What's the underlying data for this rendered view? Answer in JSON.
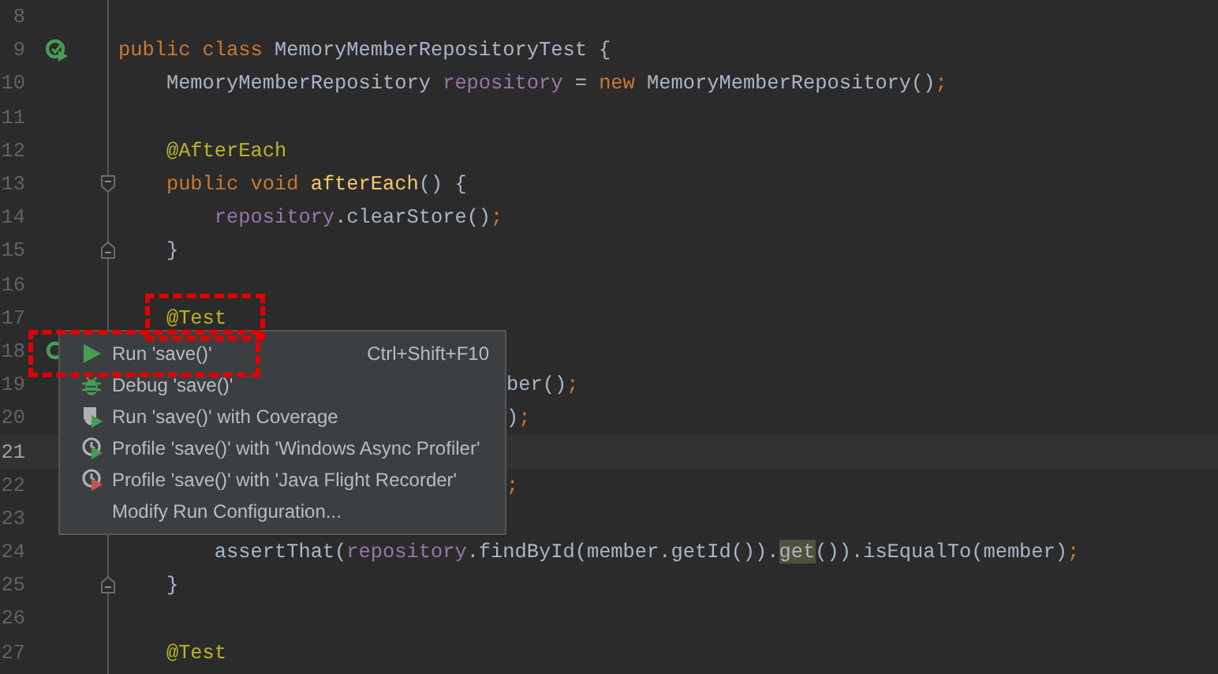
{
  "editor": {
    "lines": [
      {
        "number": "8",
        "current": false
      },
      {
        "number": "9",
        "current": false,
        "gutter_marker": {
          "kind": "run-all"
        },
        "tokens": [
          {
            "kind": "keyword",
            "text": "public class "
          },
          {
            "kind": "plain",
            "text": "MemoryMemberRepositoryTest {"
          }
        ]
      },
      {
        "number": "10",
        "current": false,
        "tokens": [
          {
            "kind": "plain",
            "text": "    MemoryMemberRepository "
          },
          {
            "kind": "field",
            "text": "repository"
          },
          {
            "kind": "plain",
            "text": " = "
          },
          {
            "kind": "keyword",
            "text": "new "
          },
          {
            "kind": "plain",
            "text": "MemoryMemberRepository()"
          },
          {
            "kind": "keyword",
            "text": ";"
          }
        ]
      },
      {
        "number": "11",
        "current": false
      },
      {
        "number": "12",
        "current": false,
        "tokens": [
          {
            "kind": "annotation",
            "text": "    @AfterEach"
          }
        ]
      },
      {
        "number": "13",
        "current": false,
        "fold_marker": {
          "kind": "start"
        },
        "tokens": [
          {
            "kind": "keyword",
            "text": "    public void "
          },
          {
            "kind": "method",
            "text": "afterEach"
          },
          {
            "kind": "plain",
            "text": "() {"
          }
        ]
      },
      {
        "number": "14",
        "current": false,
        "tokens": [
          {
            "kind": "field",
            "text": "        repository"
          },
          {
            "kind": "plain",
            "text": ".clearStore()"
          },
          {
            "kind": "keyword",
            "text": ";"
          }
        ]
      },
      {
        "number": "15",
        "current": false,
        "fold_marker": {
          "kind": "end"
        },
        "tokens": [
          {
            "kind": "plain",
            "text": "    }"
          }
        ]
      },
      {
        "number": "16",
        "current": false
      },
      {
        "number": "17",
        "current": false,
        "tokens": [
          {
            "kind": "annotation",
            "text": "    @Test"
          }
        ]
      },
      {
        "number": "18",
        "current": false,
        "gutter_marker": {
          "kind": "run"
        }
      },
      {
        "number": "19",
        "current": false,
        "covered": true,
        "tokens": [
          {
            "kind": "plain",
            "text": "ber()"
          },
          {
            "kind": "keyword",
            "text": ";"
          }
        ]
      },
      {
        "number": "20",
        "current": false,
        "covered": true,
        "tokens": [
          {
            "kind": "plain",
            "text": ")"
          },
          {
            "kind": "keyword",
            "text": ";"
          }
        ]
      },
      {
        "number": "21",
        "current": true
      },
      {
        "number": "22",
        "current": false,
        "covered": true,
        "tokens": [
          {
            "kind": "keyword",
            "text": ";"
          }
        ]
      },
      {
        "number": "23",
        "current": false
      },
      {
        "number": "24",
        "current": false,
        "tokens": [
          {
            "kind": "plain",
            "text": "        assertThat("
          },
          {
            "kind": "field",
            "text": "repository"
          },
          {
            "kind": "plain",
            "text": ".findById(member.getId())."
          },
          {
            "kind": "marked",
            "text": "get"
          },
          {
            "kind": "plain",
            "text": "()).isEqualTo(member)"
          },
          {
            "kind": "keyword",
            "text": ";"
          }
        ]
      },
      {
        "number": "25",
        "current": false,
        "fold_marker": {
          "kind": "end"
        },
        "tokens": [
          {
            "kind": "plain",
            "text": "    }"
          }
        ]
      },
      {
        "number": "26",
        "current": false
      },
      {
        "number": "27",
        "current": false,
        "tokens": [
          {
            "kind": "annotation",
            "text": "    @Test"
          }
        ]
      }
    ]
  },
  "context_menu": {
    "items": [
      {
        "kind": "run",
        "label": "Run 'save()'",
        "shortcut": "Ctrl+Shift+F10"
      },
      {
        "kind": "debug",
        "label": "Debug 'save()'"
      },
      {
        "kind": "coverage",
        "label": "Run 'save()' with Coverage"
      },
      {
        "kind": "profile",
        "label": "Profile 'save()' with 'Windows Async Profiler'"
      },
      {
        "kind": "profile-record",
        "label": "Profile 'save()' with 'Java Flight Recorder'"
      },
      {
        "kind": "none",
        "label": "Modify Run Configuration..."
      }
    ]
  }
}
